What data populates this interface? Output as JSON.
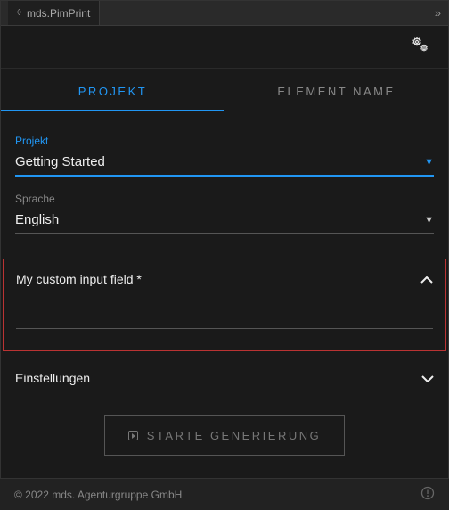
{
  "window": {
    "title": "mds.PimPrint"
  },
  "tabs": {
    "project": "PROJEKT",
    "element": "ELEMENT NAME"
  },
  "fields": {
    "project": {
      "label": "Projekt",
      "value": "Getting Started"
    },
    "language": {
      "label": "Sprache",
      "value": "English"
    },
    "custom": {
      "label": "My custom input field *",
      "value": ""
    },
    "settings": {
      "label": "Einstellungen"
    }
  },
  "actions": {
    "generate": "STARTE GENERIERUNG"
  },
  "footer": {
    "copyright": "© 2022 mds. Agenturgruppe GmbH"
  }
}
